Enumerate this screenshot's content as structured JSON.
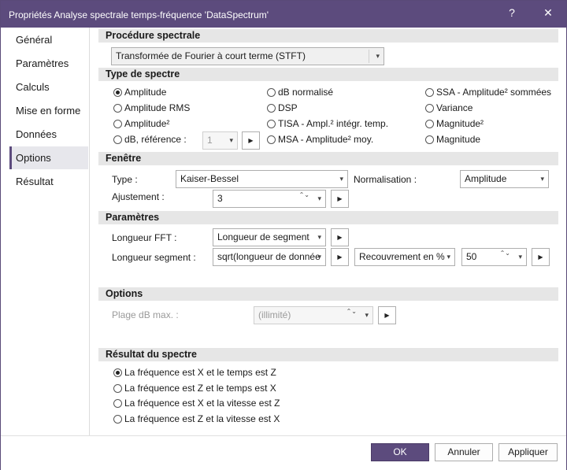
{
  "window": {
    "title": "Propriétés Analyse spectrale temps-fréquence 'DataSpectrum'",
    "help_label": "?",
    "close_label": "✕"
  },
  "sidebar": {
    "items": [
      {
        "label": "Général"
      },
      {
        "label": "Paramètres"
      },
      {
        "label": "Calculs"
      },
      {
        "label": "Mise en forme"
      },
      {
        "label": "Données"
      },
      {
        "label": "Options",
        "active": true
      },
      {
        "label": "Résultat"
      }
    ]
  },
  "procedure": {
    "header": "Procédure spectrale",
    "value": "Transformée de Fourier à court terme (STFT)"
  },
  "spectrum_type": {
    "header": "Type de spectre",
    "options": [
      {
        "label": "Amplitude",
        "checked": true
      },
      {
        "label": "Amplitude RMS"
      },
      {
        "label": "Amplitude²"
      },
      {
        "label": "dB, référence :"
      },
      {
        "label": "dB normalisé"
      },
      {
        "label": "DSP"
      },
      {
        "label": "TISA - Ampl.² intégr. temp."
      },
      {
        "label": "MSA - Amplitude² moy."
      },
      {
        "label": "SSA - Amplitude² sommées"
      },
      {
        "label": "Variance"
      },
      {
        "label": "Magnitude²"
      },
      {
        "label": "Magnitude"
      }
    ],
    "db_reference_value": "1"
  },
  "window_section": {
    "header": "Fenêtre",
    "type_label": "Type :",
    "type_value": "Kaiser-Bessel",
    "normalization_label": "Normalisation :",
    "normalization_value": "Amplitude",
    "adjust_label": "Ajustement :",
    "adjust_value": "3"
  },
  "parameters": {
    "header": "Paramètres",
    "fft_length_label": "Longueur FFT :",
    "fft_length_value": "Longueur de segment",
    "segment_length_label": "Longueur segment :",
    "segment_length_value": "sqrt(longueur de donnée",
    "overlap_mode_value": "Recouvrement en %",
    "overlap_value": "50"
  },
  "options": {
    "header": "Options",
    "db_range_label": "Plage dB max. :",
    "db_range_value": "(illimité)"
  },
  "result": {
    "header": "Résultat du spectre",
    "options": [
      {
        "label": "La fréquence est X et le temps est Z",
        "checked": true
      },
      {
        "label": "La fréquence est Z et le temps est X"
      },
      {
        "label": "La fréquence est X et la vitesse est Z"
      },
      {
        "label": "La fréquence est Z et la vitesse est X"
      }
    ]
  },
  "footer": {
    "ok_label": "OK",
    "cancel_label": "Annuler",
    "apply_label": "Appliquer"
  },
  "icons": {
    "dropdown": "▾",
    "spin": "⌃⌄",
    "arrow": "▶"
  },
  "colors": {
    "accent": "#5c4b7d"
  }
}
